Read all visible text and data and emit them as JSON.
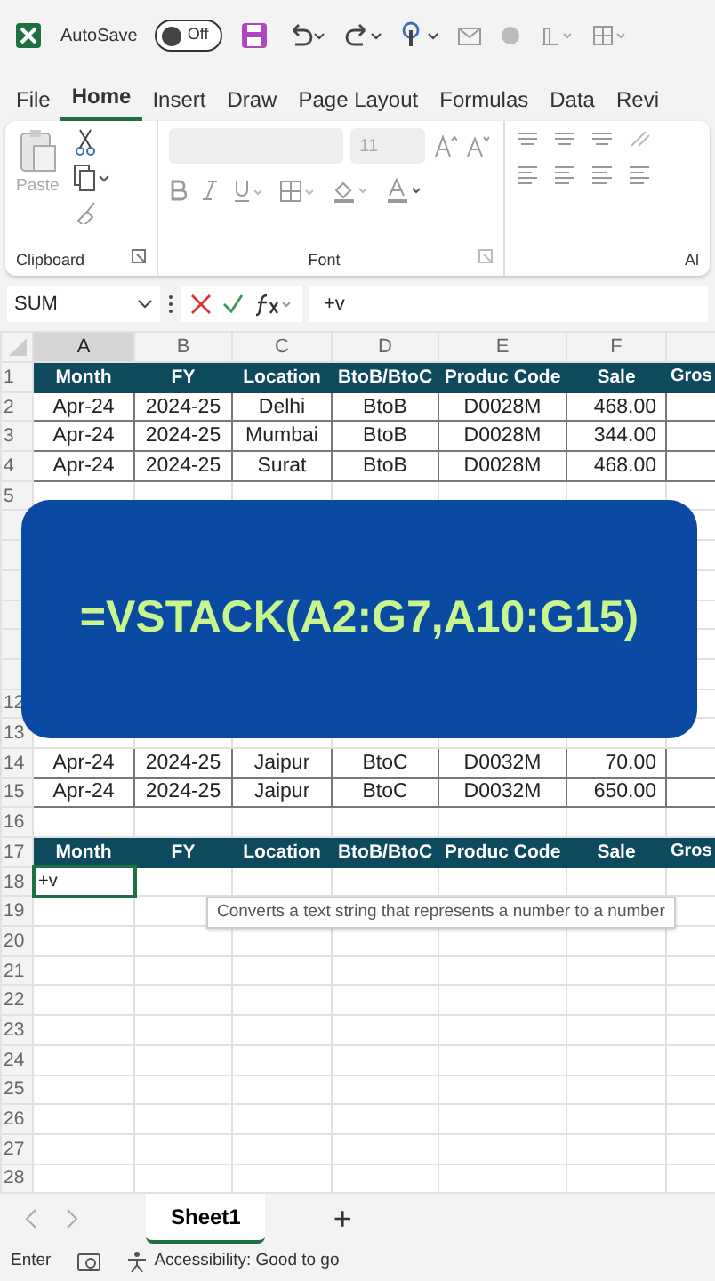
{
  "quick_access": {
    "autosave_label": "AutoSave",
    "autosave_on": false,
    "toggle_text": "Off"
  },
  "menu_tabs": [
    {
      "label": "File",
      "selected": false
    },
    {
      "label": "Home",
      "selected": true
    },
    {
      "label": "Insert",
      "selected": false
    },
    {
      "label": "Draw",
      "selected": false
    },
    {
      "label": "Page Layout",
      "selected": false
    },
    {
      "label": "Formulas",
      "selected": false
    },
    {
      "label": "Data",
      "selected": false
    },
    {
      "label": "Revi",
      "selected": false
    }
  ],
  "ribbon": {
    "paste_label": "Paste",
    "font_size": "11",
    "groups": [
      {
        "label": "Clipboard"
      },
      {
        "label": "Font"
      },
      {
        "label": "Al"
      }
    ]
  },
  "formula_bar": {
    "name_box": "SUM",
    "formula": "+v"
  },
  "columns": [
    {
      "label": "A",
      "selected": true
    },
    {
      "label": "B",
      "selected": false
    },
    {
      "label": "C",
      "selected": false
    },
    {
      "label": "D",
      "selected": false
    },
    {
      "label": "E",
      "selected": false
    },
    {
      "label": "F",
      "selected": false
    },
    {
      "selected": false
    }
  ],
  "rows": [
    {
      "number": "1",
      "kind": "header",
      "cells": [
        "Month",
        "FY",
        "Location",
        "BtoB/BtoC",
        "Produc Code",
        "Sale",
        "Gros"
      ]
    },
    {
      "number": "2",
      "kind": "data",
      "cells": [
        "Apr-24",
        "2024-25",
        "Delhi",
        "BtoB",
        "D0028M",
        "468.00",
        ""
      ]
    },
    {
      "number": "3",
      "kind": "data",
      "cells": [
        "Apr-24",
        "2024-25",
        "Mumbai",
        "BtoB",
        "D0028M",
        "344.00",
        ""
      ]
    },
    {
      "number": "4",
      "kind": "data",
      "cells": [
        "Apr-24",
        "2024-25",
        "Surat",
        "BtoB",
        "D0028M",
        "468.00",
        ""
      ]
    },
    {
      "number": "5",
      "kind": "covered"
    },
    {
      "number": "",
      "kind": "covered"
    },
    {
      "number": "",
      "kind": "covered"
    },
    {
      "number": "",
      "kind": "covered"
    },
    {
      "number": "",
      "kind": "covered"
    },
    {
      "number": "",
      "kind": "covered"
    },
    {
      "number": "",
      "kind": "covered"
    },
    {
      "number": "12",
      "kind": "covered"
    },
    {
      "number": "13",
      "kind": "covered"
    },
    {
      "number": "14",
      "kind": "data",
      "cells": [
        "Apr-24",
        "2024-25",
        "Jaipur",
        "BtoC",
        "D0032M",
        "70.00",
        ""
      ]
    },
    {
      "number": "15",
      "kind": "data",
      "cells": [
        "Apr-24",
        "2024-25",
        "Jaipur",
        "BtoC",
        "D0032M",
        "650.00",
        ""
      ]
    },
    {
      "number": "16",
      "kind": "empty"
    },
    {
      "number": "17",
      "kind": "header",
      "cells": [
        "Month",
        "FY",
        "Location",
        "BtoB/BtoC",
        "Produc Code",
        "Sale",
        "Gros"
      ]
    },
    {
      "number": "18",
      "kind": "editing",
      "text": "+v"
    },
    {
      "number": "19",
      "kind": "empty"
    },
    {
      "number": "20",
      "kind": "empty"
    },
    {
      "number": "21",
      "kind": "empty"
    },
    {
      "number": "22",
      "kind": "empty"
    },
    {
      "number": "23",
      "kind": "empty"
    },
    {
      "number": "24",
      "kind": "empty"
    },
    {
      "number": "25",
      "kind": "empty"
    },
    {
      "number": "26",
      "kind": "empty"
    },
    {
      "number": "27",
      "kind": "empty"
    },
    {
      "number": "28",
      "kind": "empty"
    }
  ],
  "tooltip": "Converts a text string that represents a number to a number",
  "overlay_text": "=VSTACK(A2:G7,A10:G15)",
  "sheet_tabs": [
    {
      "label": "Sheet1",
      "selected": true
    }
  ],
  "add_sheet": "+",
  "status_bar": {
    "mode": "Enter",
    "accessibility": "Accessibility: Good to go"
  }
}
